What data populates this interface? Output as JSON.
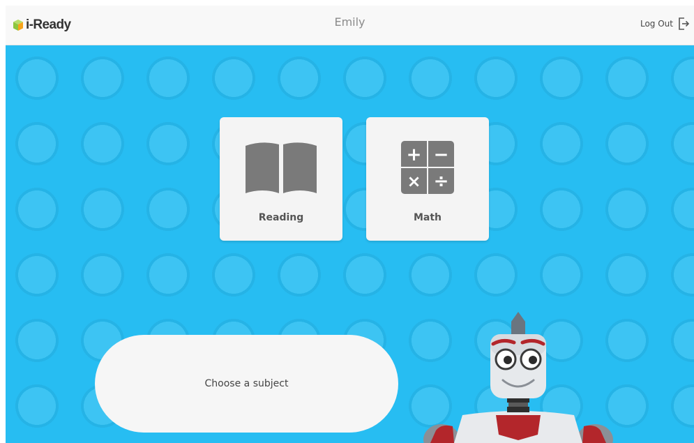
{
  "header": {
    "logo_text": "i-Ready",
    "username": "Emily",
    "logout_label": "Log Out"
  },
  "subjects": [
    {
      "label": "Reading",
      "icon": "book-icon"
    },
    {
      "label": "Math",
      "icon": "calculator-operations-icon"
    }
  ],
  "prompt": "Choose a subject",
  "math_symbols": [
    "+",
    "−",
    "×",
    "÷"
  ],
  "colors": {
    "background_blue": "#27bdf2",
    "card": "#f4f4f4",
    "icon_gray": "#7a7a7a",
    "logo_green": "#8cc63f",
    "robot_red": "#b3262b"
  }
}
